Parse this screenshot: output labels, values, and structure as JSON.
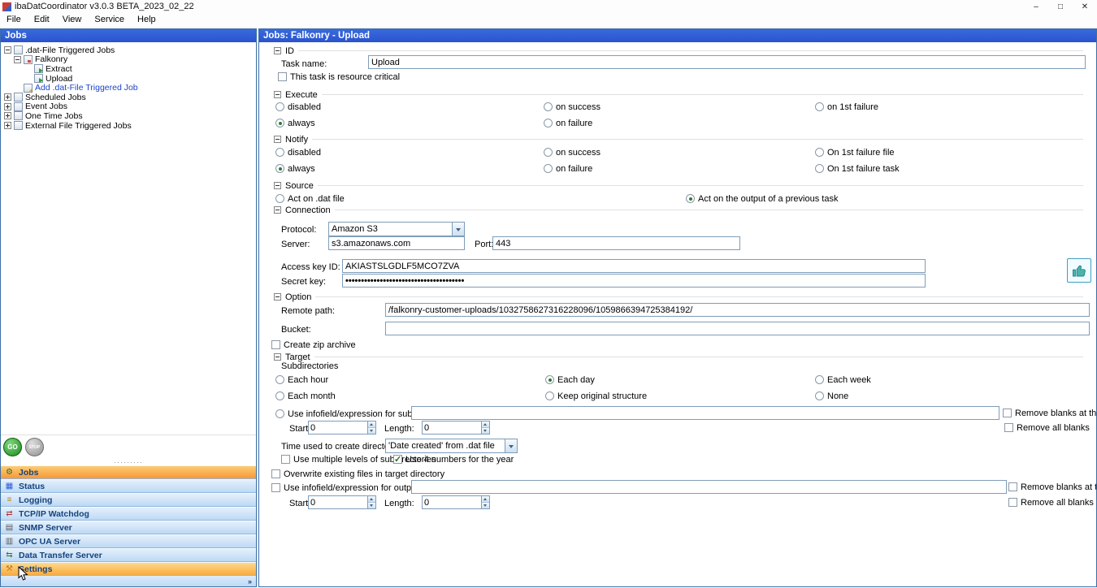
{
  "window": {
    "title": "ibaDatCoordinator v3.0.3 BETA_2023_02_22",
    "controls": {
      "minimize": "–",
      "maximize": "□",
      "close": "✕"
    }
  },
  "menu": {
    "items": [
      "File",
      "Edit",
      "View",
      "Service",
      "Help"
    ]
  },
  "colors": {
    "header_blue": "#2b5cd9",
    "nav_selected_orange": "#f6993a",
    "nav_hover_orange": "#f9ab42",
    "radio_selected_green": "#2d7d2d"
  },
  "sidebar": {
    "header": "Jobs",
    "tree": {
      "dat_root": ".dat-File Triggered Jobs",
      "falkonry": "Falkonry",
      "extract": "Extract",
      "upload": "Upload",
      "add_link": "Add .dat-File Triggered Job",
      "scheduled": "Scheduled Jobs",
      "event": "Event Jobs",
      "one_time": "One Time Jobs",
      "external": "External File Triggered Jobs"
    },
    "go_button": "GO",
    "stop_button": "STOP",
    "nav": {
      "jobs": "Jobs",
      "status": "Status",
      "logging": "Logging",
      "tcpip": "TCP/IP Watchdog",
      "snmp": "SNMP Server",
      "opcua": "OPC UA Server",
      "dts": "Data Transfer Server",
      "settings": "Settings",
      "active": "Jobs"
    },
    "icons": {
      "jobs": "⚙",
      "status": "▦",
      "logging": "≡",
      "tcpip": "⇄",
      "snmp": "▤",
      "opcua": "▥",
      "dts": "⇆",
      "settings": "⚒"
    },
    "expander": "»"
  },
  "main": {
    "header": "Jobs: Falkonry - Upload",
    "id": {
      "title": "ID",
      "task_name_label": "Task name:",
      "task_name_value": "Upload",
      "resource_critical_label": "This task is resource critical",
      "resource_critical_checked": false
    },
    "execute": {
      "title": "Execute",
      "opt_disabled": "disabled",
      "opt_on_success": "on success",
      "opt_on_1st_failure": "on 1st failure",
      "opt_always": "always",
      "opt_on_failure": "on failure",
      "selected": "always"
    },
    "notify": {
      "title": "Notify",
      "opt_disabled": "disabled",
      "opt_on_success": "on success",
      "opt_on_1st_failure_file": "On 1st failure file",
      "opt_always": "always",
      "opt_on_failure": "on failure",
      "opt_on_1st_failure_task": "On 1st failure task",
      "selected": "always"
    },
    "source": {
      "title": "Source",
      "opt_dat_file": "Act on .dat file",
      "opt_prev_task": "Act on the output of a previous task",
      "selected": "Act on the output of a previous task"
    },
    "connection": {
      "title": "Connection",
      "protocol_label": "Protocol:",
      "protocol_value": "Amazon S3",
      "server_label": "Server:",
      "server_value": "s3.amazonaws.com",
      "port_label": "Port:",
      "port_value": "443",
      "access_key_label": "Access key ID:",
      "access_key_value": "AKIASTSLGDLF5MCO7ZVA",
      "secret_key_label": "Secret key:",
      "secret_key_value": "••••••••••••••••••••••••••••••••••••••"
    },
    "option": {
      "title": "Option",
      "remote_path_label": "Remote path:",
      "remote_path_value": "/falkonry-customer-uploads/1032758627316228096/1059866394725384192/",
      "bucket_label": "Bucket:",
      "bucket_value": "",
      "zip_label": "Create zip archive",
      "zip_checked": false
    },
    "target": {
      "title": "Target",
      "subdirs_label": "Subdirectories",
      "opt_each_hour": "Each hour",
      "opt_each_day": "Each day",
      "opt_each_week": "Each week",
      "opt_each_month": "Each month",
      "opt_keep_original": "Keep original structure",
      "opt_none": "None",
      "selected": "Each day",
      "expr_label": "Use infofield/expression for subdirectory:",
      "expr_value": "",
      "remove_blanks_end_label": "Remove blanks at the end",
      "remove_all_blanks_label": "Remove all blanks",
      "start_label": "Start:",
      "start_value": "0",
      "length_label": "Length:",
      "length_value": "0",
      "time_label": "Time used to create directory:",
      "time_value": "'Date created' from .dat file",
      "multi_level_label": "Use multiple levels of subdirectories",
      "multi_level_checked": false,
      "year4_label": "Use 4 numbers for the year",
      "year4_checked": true
    },
    "output": {
      "overwrite_label": "Overwrite existing files in target directory",
      "overwrite_checked": false,
      "outname_label": "Use infofield/expression for output file name:",
      "outname_value": "",
      "remove_blanks_end_label": "Remove blanks at the end",
      "remove_all_blanks_label": "Remove all blanks",
      "start_label": "Start:",
      "start_value": "0",
      "length_label": "Length:",
      "length_value": "0"
    }
  }
}
